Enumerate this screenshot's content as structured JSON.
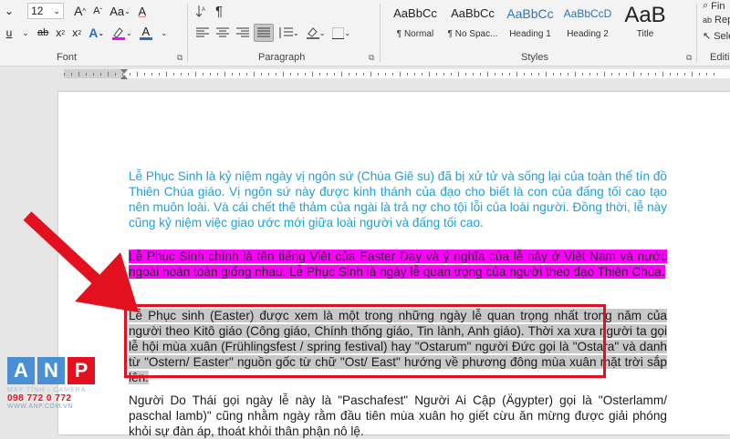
{
  "ribbon": {
    "font": {
      "size_value": "12",
      "label": "Font",
      "row1_icons": [
        "A",
        "A",
        "Aa",
        "A"
      ],
      "row2_icons": [
        "u",
        "ab",
        "x",
        "x"
      ]
    },
    "paragraph": {
      "label": "Paragraph",
      "pilcrow": "¶"
    },
    "styles": {
      "label": "Styles",
      "items": [
        {
          "preview": "AaBbCc",
          "name": "¶ Normal"
        },
        {
          "preview": "AaBbCc",
          "name": "¶ No Spac..."
        },
        {
          "preview": "AaBbCc",
          "name": "Heading 1"
        },
        {
          "preview": "AaBbCcD",
          "name": "Heading 2"
        },
        {
          "preview": "AaB",
          "name": "Title"
        }
      ]
    },
    "editing": {
      "label": "Editi",
      "items": [
        "Fin",
        "Rep",
        "Sele"
      ]
    }
  },
  "document": {
    "p1": "Lễ Phục Sinh là kỷ niệm ngày vị ngôn sứ (Chúa Giê su) đã bị xử tử và sống lại của toàn thể tín đồ Thiên Chúa giáo. Vị ngôn sứ này được kinh thánh của đạo cho biết là con của đấng tối cao tạo nên muôn loài. Và cái chết thê thảm của ngài là trả nợ cho tội lỗi của loài người. Đồng thời, lễ này cũng kỷ niệm việc giao ước mới giữa loài người và đấng tối cao.",
    "p2": "Lễ Phục Sinh chính là tên tiếng Việt của Easter Day và ý nghĩa của lễ này ở Việt Nam và nước ngoài hoàn toàn giống nhau. Lễ Phục Sinh là ngày lễ quan trọng của người theo đạo Thiên Chúa.",
    "p3": "Lễ Phục sinh (Easter) được xem là một trong những ngày lễ quan trọng nhất trong năm của người theo Kitô giáo (Công giáo, Chính thống giáo, Tin lành, Anh giáo). Thời xa xưa người ta gọi lễ hội mùa xuân (Frühlingsfest / spring festival) hay \"Ostarum\" người Đức gọi là \"Ostara\" và danh từ \"Ostern/ Easter\" nguồn gốc từ chữ \"Ost/ East\" hướng về phương đông mùa xuân mặt trời sắp lên.",
    "p4": "Người Do Thái gọi ngày lễ này là \"Paschafest\" Người Ai Cập (Ägypter) gọi là \"Osterlamm/ paschal lamb)\" cũng nhằm ngày rằm đầu tiên mùa xuân họ giết cừu ăn mừng được giải phóng khỏi sự đàn áp, thoát khỏi thân phận nô lệ."
  },
  "colors": {
    "p1_text": "#1f9fd8",
    "p2_highlight": "#ff00ff",
    "p3_highlight": "#c8c8c8",
    "annotation_red": "#e3111f",
    "logo_blue": "#4a8fd1"
  },
  "logo": {
    "letters": [
      "A",
      "N",
      "P"
    ],
    "subtitle": "MÁY TÍNH - CAMERA",
    "phone": "098 772 0 772",
    "website": "WWW.ANP.COM.VN"
  }
}
